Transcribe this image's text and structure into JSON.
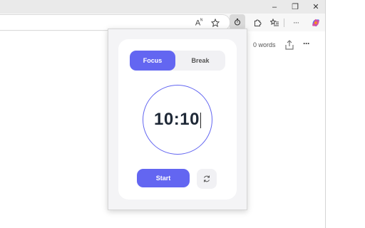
{
  "window": {
    "minimize_glyph": "–",
    "restore_glyph": "❐",
    "close_glyph": "✕"
  },
  "toolbar": {
    "read_aloud_glyph": "A",
    "read_aloud_superscript": "ᴺ",
    "more_glyph": "···"
  },
  "page": {
    "word_count": "0 words",
    "more_glyph": "···"
  },
  "popup": {
    "tabs": [
      {
        "label": "Focus",
        "active": true
      },
      {
        "label": "Break",
        "active": false
      }
    ],
    "timer_display": "10:10",
    "start_label": "Start",
    "accent_color": "#6366f1"
  }
}
